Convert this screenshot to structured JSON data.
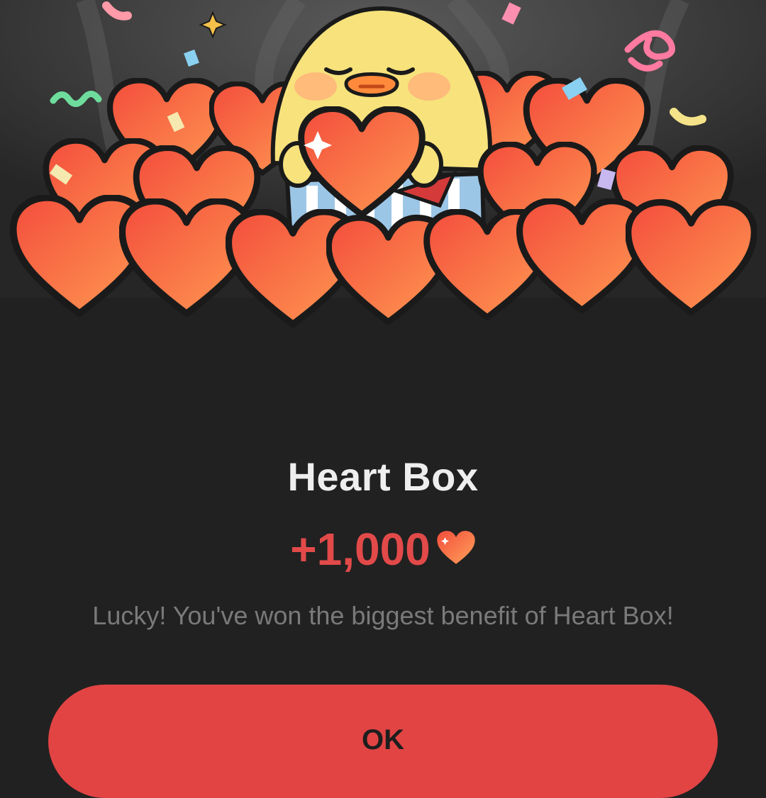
{
  "dialog": {
    "title": "Heart Box",
    "reward_amount": "+1,000",
    "reward_icon": "heart-icon",
    "message": "Lucky! You've won the biggest benefit of Heart Box!",
    "ok_label": "OK"
  },
  "illustration": {
    "subject": "chick-holding-heart",
    "icons": [
      "chick-icon",
      "heart-icon",
      "gift-box-icon",
      "confetti-icon",
      "sparkle-icon"
    ]
  },
  "colors": {
    "background": "#212121",
    "accent": "#e24444",
    "heart_light": "#ff8a4d",
    "heart_dark": "#f04a3a",
    "title_text": "#eeeeee",
    "message_text": "#7a7a7a"
  }
}
